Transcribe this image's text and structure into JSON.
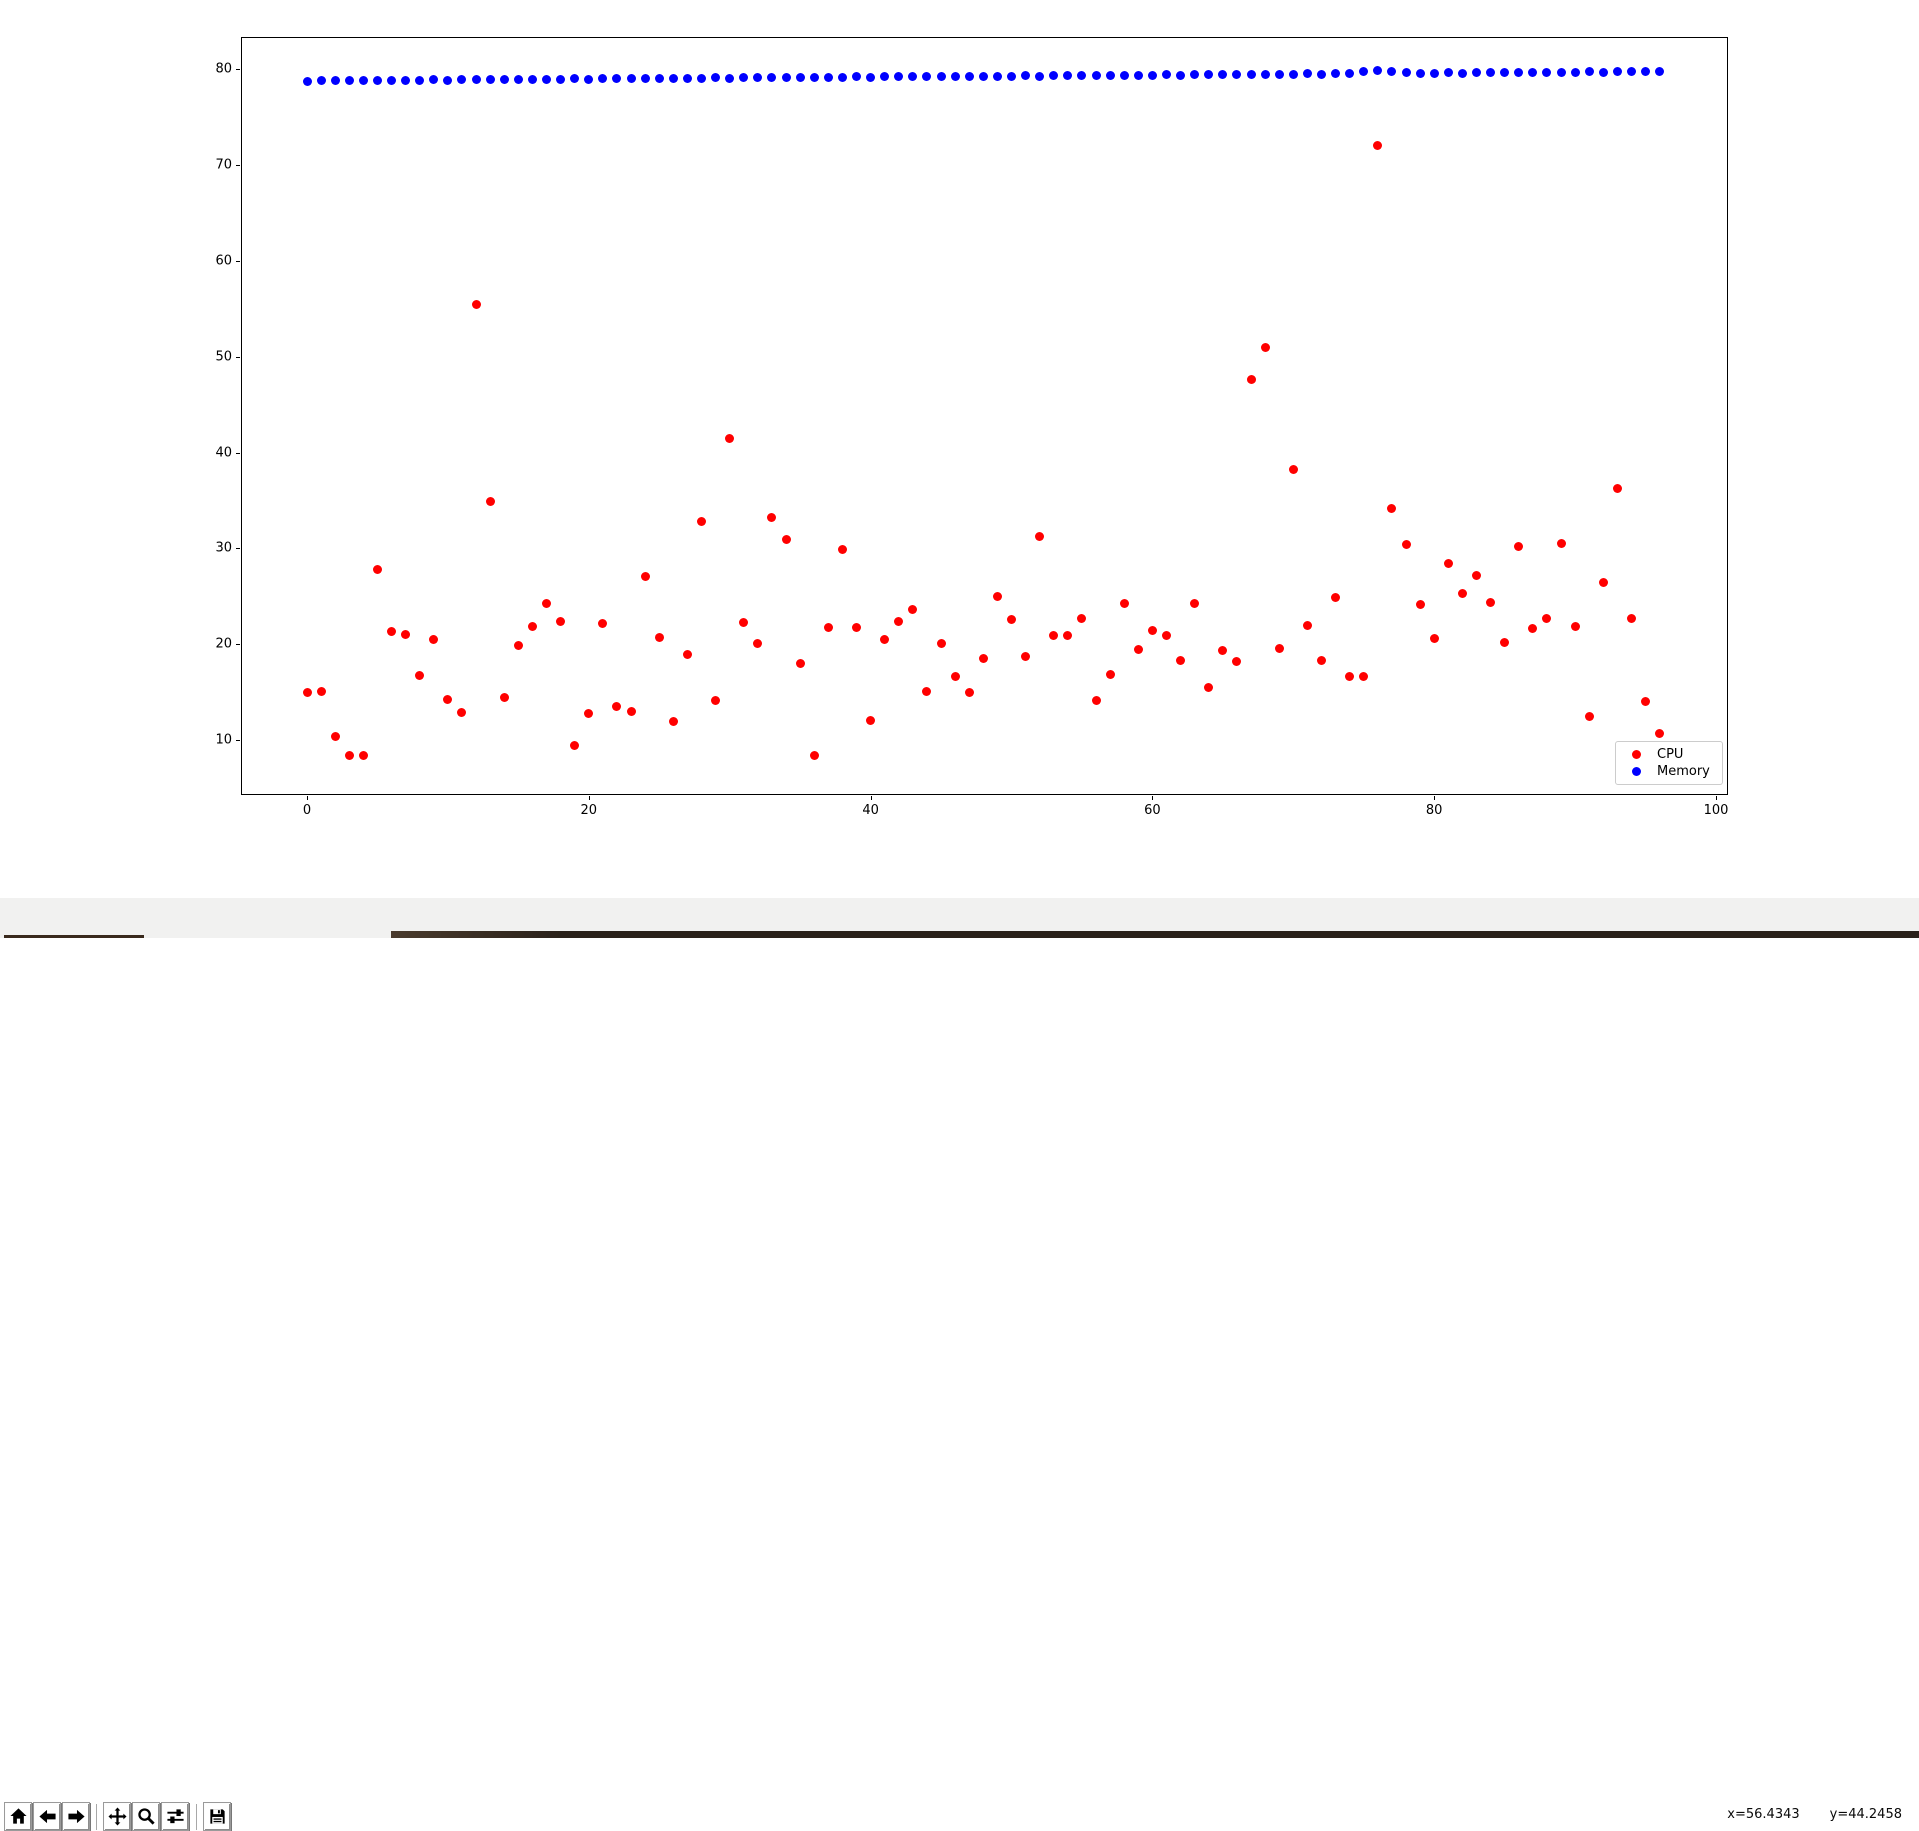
{
  "chart_data": {
    "type": "scatter",
    "title": "",
    "xlabel": "",
    "ylabel": "",
    "grid": false,
    "xlim": [
      -4.8,
      100.8
    ],
    "ylim": [
      4.3,
      83.3
    ],
    "x_ticks": [
      0,
      20,
      40,
      60,
      80,
      100
    ],
    "y_ticks": [
      10,
      20,
      30,
      40,
      50,
      60,
      70,
      80
    ],
    "legend": {
      "position": "lower right",
      "entries": [
        {
          "label": "CPU",
          "color": "#ff0000"
        },
        {
          "label": "Memory",
          "color": "#0000ff"
        }
      ]
    },
    "series": [
      {
        "name": "CPU",
        "color": "#ff0000",
        "marker": "circle",
        "x": [
          0,
          1,
          2,
          3,
          4,
          5,
          6,
          7,
          8,
          9,
          10,
          11,
          12,
          13,
          14,
          15,
          16,
          17,
          18,
          19,
          20,
          21,
          22,
          23,
          24,
          25,
          26,
          27,
          28,
          29,
          30,
          31,
          32,
          33,
          34,
          35,
          36,
          37,
          38,
          39,
          40,
          41,
          42,
          43,
          44,
          45,
          46,
          47,
          48,
          49,
          50,
          51,
          52,
          53,
          54,
          55,
          56,
          57,
          58,
          59,
          60,
          61,
          62,
          63,
          64,
          65,
          66,
          67,
          68,
          69,
          70,
          71,
          72,
          73,
          74,
          75,
          76,
          77,
          78,
          79,
          80,
          81,
          82,
          83,
          84,
          85,
          86,
          87,
          88,
          89,
          90,
          91,
          92,
          93,
          94,
          95,
          96
        ],
        "y": [
          15.0,
          15.1,
          10.4,
          8.4,
          8.4,
          27.8,
          21.3,
          21.0,
          16.7,
          20.5,
          14.2,
          12.9,
          55.4,
          34.9,
          14.4,
          19.9,
          21.9,
          24.3,
          22.4,
          9.4,
          12.8,
          22.2,
          13.5,
          13.0,
          27.1,
          20.7,
          11.9,
          18.9,
          32.8,
          14.1,
          41.5,
          22.3,
          20.1,
          33.2,
          30.9,
          18.0,
          8.4,
          21.8,
          29.9,
          21.8,
          12.1,
          20.5,
          22.4,
          23.6,
          15.1,
          20.1,
          16.6,
          15.0,
          18.5,
          25.0,
          22.6,
          18.7,
          31.2,
          20.9,
          20.9,
          22.7,
          14.1,
          16.8,
          24.3,
          19.5,
          21.4,
          20.9,
          18.3,
          24.3,
          15.5,
          19.4,
          18.2,
          47.6,
          51.0,
          19.6,
          38.2,
          22.0,
          18.3,
          24.9,
          16.6,
          16.6,
          72.0,
          34.2,
          30.4,
          24.2,
          20.6,
          28.4,
          25.3,
          27.2,
          24.4,
          20.2,
          30.2,
          21.6,
          22.7,
          30.5,
          21.9,
          12.5,
          26.4,
          36.2,
          22.7,
          14.0,
          10.7
        ]
      },
      {
        "name": "Memory",
        "color": "#0000ff",
        "marker": "circle",
        "x": [
          0,
          1,
          2,
          3,
          4,
          5,
          6,
          7,
          8,
          9,
          10,
          11,
          12,
          13,
          14,
          15,
          16,
          17,
          18,
          19,
          20,
          21,
          22,
          23,
          24,
          25,
          26,
          27,
          28,
          29,
          30,
          31,
          32,
          33,
          34,
          35,
          36,
          37,
          38,
          39,
          40,
          41,
          42,
          43,
          44,
          45,
          46,
          47,
          48,
          49,
          50,
          51,
          52,
          53,
          54,
          55,
          56,
          57,
          58,
          59,
          60,
          61,
          62,
          63,
          64,
          65,
          66,
          67,
          68,
          69,
          70,
          71,
          72,
          73,
          74,
          75,
          76,
          77,
          78,
          79,
          80,
          81,
          82,
          83,
          84,
          85,
          86,
          87,
          88,
          89,
          90,
          91,
          92,
          93,
          94,
          95,
          96
        ],
        "y": [
          78.76,
          78.8,
          78.78,
          78.82,
          78.8,
          78.84,
          78.82,
          78.85,
          78.84,
          78.88,
          78.86,
          78.9,
          78.88,
          78.92,
          78.9,
          78.93,
          78.92,
          78.96,
          78.94,
          78.98,
          78.96,
          79.0,
          78.98,
          79.02,
          79.0,
          79.03,
          79.02,
          79.06,
          79.04,
          79.08,
          79.06,
          79.1,
          79.08,
          79.12,
          79.1,
          79.13,
          79.12,
          79.16,
          79.14,
          79.18,
          79.16,
          79.2,
          79.18,
          79.22,
          79.2,
          79.23,
          79.22,
          79.26,
          79.24,
          79.28,
          79.26,
          79.3,
          79.28,
          79.32,
          79.3,
          79.33,
          79.32,
          79.36,
          79.34,
          79.38,
          79.36,
          79.4,
          79.38,
          79.42,
          79.4,
          79.43,
          79.42,
          79.46,
          79.44,
          79.48,
          79.46,
          79.5,
          79.48,
          79.52,
          79.5,
          79.7,
          79.85,
          79.8,
          79.62,
          79.58,
          79.56,
          79.6,
          79.58,
          79.62,
          79.6,
          79.63,
          79.62,
          79.66,
          79.64,
          79.68,
          79.66,
          79.7,
          79.68,
          79.72,
          79.7,
          79.73,
          79.72
        ]
      }
    ]
  },
  "toolbar": {
    "buttons": [
      {
        "id": "home",
        "icon": "home-icon"
      },
      {
        "id": "back",
        "icon": "arrow-left-icon"
      },
      {
        "id": "forward",
        "icon": "arrow-right-icon"
      },
      {
        "id": "pan",
        "icon": "move-cross-icon"
      },
      {
        "id": "zoom",
        "icon": "magnifier-icon"
      },
      {
        "id": "configure-subplots",
        "icon": "sliders-icon"
      },
      {
        "id": "save",
        "icon": "floppy-disk-icon"
      }
    ]
  },
  "statusbar": {
    "x_readout": "x=56.4343",
    "y_readout": "y=44.2458"
  }
}
